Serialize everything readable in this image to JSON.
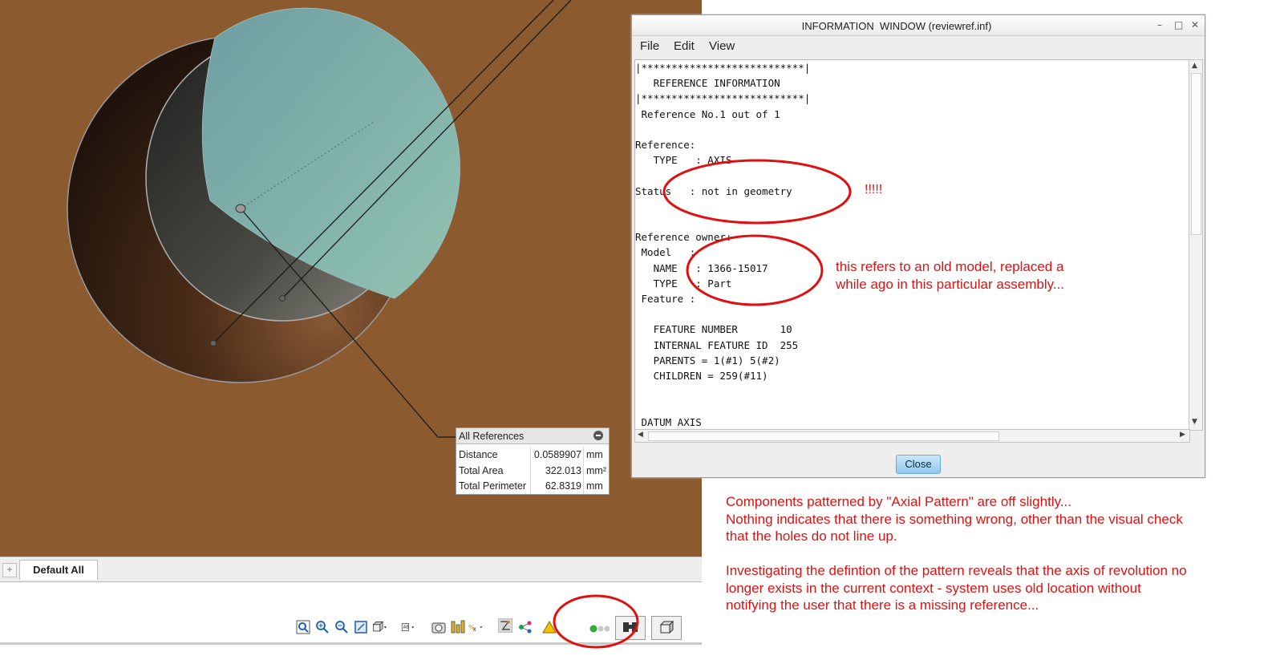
{
  "info_window": {
    "title": "INFORMATION  WINDOW (reviewref.inf)",
    "window_controls": [
      "–",
      "□",
      "✕"
    ],
    "menu": [
      "File",
      "Edit",
      "View"
    ],
    "report_lines": [
      "|***************************|",
      "   REFERENCE INFORMATION",
      "|***************************|",
      " Reference No.1 out of 1",
      "",
      "Reference:",
      "   TYPE   : AXIS",
      "",
      "Status   : not in geometry",
      "",
      "",
      "Reference owner:",
      " Model   :",
      "   NAME   : 1366-15017",
      "   TYPE   : Part",
      " Feature :",
      "",
      "   FEATURE NUMBER       10",
      "   INTERNAL FEATURE ID  255",
      "   PARENTS = 1(#1) 5(#2)",
      "   CHILDREN = 259(#11)",
      "",
      "",
      " DATUM AXIS"
    ],
    "close_label": "Close"
  },
  "all_references": {
    "title": "All References",
    "rows": [
      {
        "label": "Distance",
        "value": "0.0589907",
        "unit": "mm"
      },
      {
        "label": "Total Area",
        "value": "322.013",
        "unit": "mm²"
      },
      {
        "label": "Total Perimeter",
        "value": "62.8319",
        "unit": "mm"
      }
    ]
  },
  "tabs": {
    "add_label": "+",
    "default_label": "Default All"
  },
  "annotations": {
    "exclaim": "!!!!!",
    "old_model_note": "this refers to an old model, replaced a\nwhile ago in this particular assembly...",
    "main_note": "Components patterned by \"Axial Pattern\" are off slightly...\nNothing indicates that there is something wrong, other than the visual check\nthat the holes do not line up.\n\nInvestigating the defintion of the pattern reveals that the axis of revolution no\nlonger exists in the current context - system uses old location without\nnotifying the user that there is a missing reference..."
  },
  "toolbar_icons": [
    "refit-icon",
    "zoom-in-icon",
    "zoom-out-icon",
    "repaint-icon",
    "view-orientation-icon",
    "saved-views-icon",
    "appearance-icon",
    "display-style-icon",
    "perspective-icon",
    "datum-display-icon",
    "spin-center-icon",
    "annotation-display-icon",
    "node-icon",
    "warning-icon",
    "status-dots-icon",
    "find-icon",
    "box-select-icon"
  ],
  "colors": {
    "viewport_bg": "#8b5a2e",
    "annotation_red": "#e01010",
    "close_button": "#a9d6f5"
  }
}
